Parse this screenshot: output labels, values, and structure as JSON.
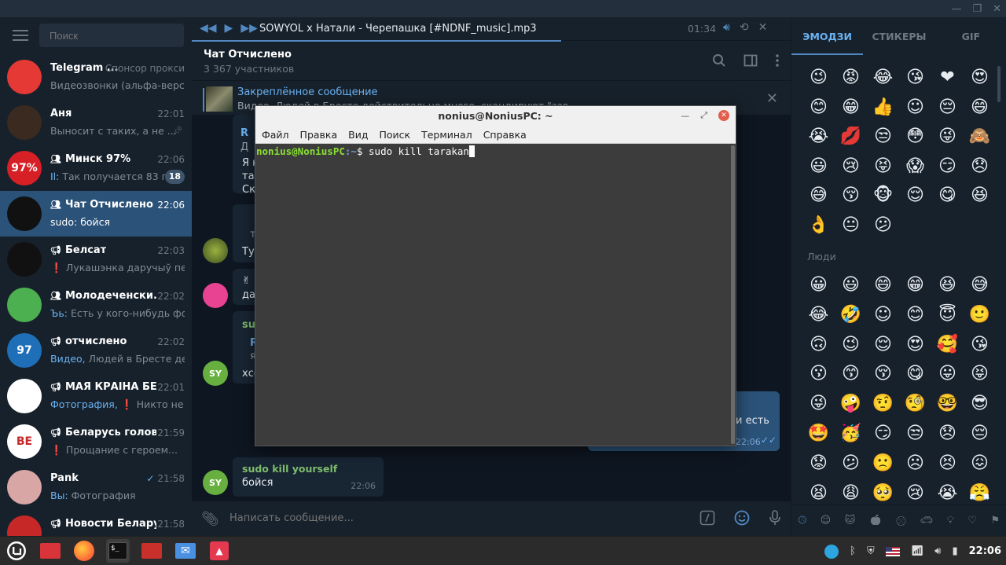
{
  "search": {
    "placeholder": "Поиск"
  },
  "chats": [
    {
      "title": "Telegram ...",
      "time": "Спонсор прокси",
      "preview": "Видеозвонки (альфа-верси...",
      "avatar_color": "#e53935",
      "avatar_text": ""
    },
    {
      "title": "Аня",
      "time": "22:01",
      "preview": "Выносит с таких, а не ...",
      "avatar_color": "#3a2a20",
      "avatar_text": "",
      "pinned": true
    },
    {
      "title": "Минск 97%",
      "time": "22:06",
      "prev_hl": "Il: ",
      "preview": "Так получается 83 п...",
      "badge": "18",
      "avatar_color": "#d71f26",
      "avatar_text": "97%",
      "group": true
    },
    {
      "title": "Чат Отчислено",
      "time": "22:06",
      "preview": "sudo: бойся",
      "avatar_color": "#111",
      "avatar_text": "",
      "group": true,
      "active": true
    },
    {
      "title": "Белсат",
      "time": "22:03",
      "prev_red": "❗ ",
      "preview": "Лукашэнка даручыў пе...",
      "avatar_color": "#111",
      "avatar_text": "",
      "channel": true
    },
    {
      "title": "Молодеченски...",
      "time": "22:02",
      "prev_hl": "Ъь: ",
      "preview": "Есть у кого-нибудь фот...",
      "avatar_color": "#4caf50",
      "avatar_text": "",
      "group": true
    },
    {
      "title": "отчислено",
      "time": "22:02",
      "prev_hl": "Видео, ",
      "preview": "Людей в Бресте дей...",
      "avatar_color": "#1e6fb8",
      "avatar_text": "97",
      "channel": true
    },
    {
      "title": "МАЯ КРАІНА БЕЛ...",
      "time": "22:01",
      "prev_hl": "Фотография, ",
      "prev_red2": "❗ ",
      "preview": "Никто не з...",
      "avatar_color": "#fff",
      "avatar_text": "",
      "channel": true
    },
    {
      "title": "Беларусь головн...",
      "time": "21:59",
      "prev_red": "❗ ",
      "preview": "Прощание с героем...",
      "avatar_color": "#fff",
      "avatar_text": "BE",
      "channel": true
    },
    {
      "title": "Pank",
      "time": "21:58",
      "prev_hl": "Вы: ",
      "preview": "Фотография",
      "avatar_color": "#d9a6a6",
      "avatar_text": "",
      "read": true
    },
    {
      "title": "Новости Беларусь...",
      "time": "21:58",
      "preview": "",
      "avatar_color": "#c62828",
      "avatar_text": "",
      "channel": true
    }
  ],
  "player": {
    "track": "SOWYOL x Натали - Черепашка [#NDNF_music].mp3",
    "time": "01:34"
  },
  "chat_header": {
    "title": "Чат Отчислено",
    "subtitle": "3 367 участников"
  },
  "pinned": {
    "title": "Закреплённое сообщение",
    "text": "Видео, Людей в Бресте действительно много, скандируют \"завтра в 2\""
  },
  "messages": {
    "snippets": [
      "R",
      "Д",
      "Я к",
      "так",
      "Ска",
      "т",
      "Тут",
      "да",
      "suc",
      "R",
      "я",
      "хсо",
      "и есть",
      "22:06"
    ],
    "last": {
      "author": "sudo kill yourself",
      "text": "бойся",
      "time": "22:06"
    },
    "avatar_initials": "SY"
  },
  "composer": {
    "placeholder": "Написать сообщение..."
  },
  "emoji_panel": {
    "tabs": [
      "ЭМОДЗИ",
      "СТИКЕРЫ",
      "GIF"
    ],
    "recent": [
      "😉",
      "😡",
      "😂",
      "😘",
      "❤",
      "😍",
      "😊",
      "😁",
      "👍",
      "☺",
      "😔",
      "😄",
      "😭",
      "💋",
      "😒",
      "😳",
      "😜",
      "🙈",
      "😃",
      "😢",
      "😝",
      "😱",
      "😏",
      "😞",
      "😅",
      "😚",
      "🐵",
      "😌",
      "😋",
      "😆",
      "👌",
      "😐",
      "😕"
    ],
    "people_label": "Люди",
    "people": [
      "😀",
      "😃",
      "😄",
      "😁",
      "😆",
      "😅",
      "😂",
      "🤣",
      "☺",
      "😊",
      "😇",
      "🙂",
      "🙃",
      "😉",
      "😌",
      "😍",
      "🥰",
      "😘",
      "😗",
      "😙",
      "😚",
      "😋",
      "😛",
      "😝",
      "😜",
      "🤪",
      "🤨",
      "🧐",
      "🤓",
      "😎",
      "🤩",
      "🥳",
      "😏",
      "😒",
      "😞",
      "😔",
      "😟",
      "😕",
      "🙁",
      "☹",
      "😣",
      "😖",
      "😫",
      "😩",
      "🥺",
      "😢",
      "😭",
      "😤"
    ]
  },
  "terminal": {
    "title": "nonius@NoniusPC: ~",
    "menu": [
      "Файл",
      "Правка",
      "Вид",
      "Поиск",
      "Терминал",
      "Справка"
    ],
    "user_host": "nonius@NoniusPC",
    "path": ":~",
    "prompt": "$ ",
    "command": "sudo kill tarakan"
  },
  "taskbar": {
    "clock": "22:06"
  }
}
